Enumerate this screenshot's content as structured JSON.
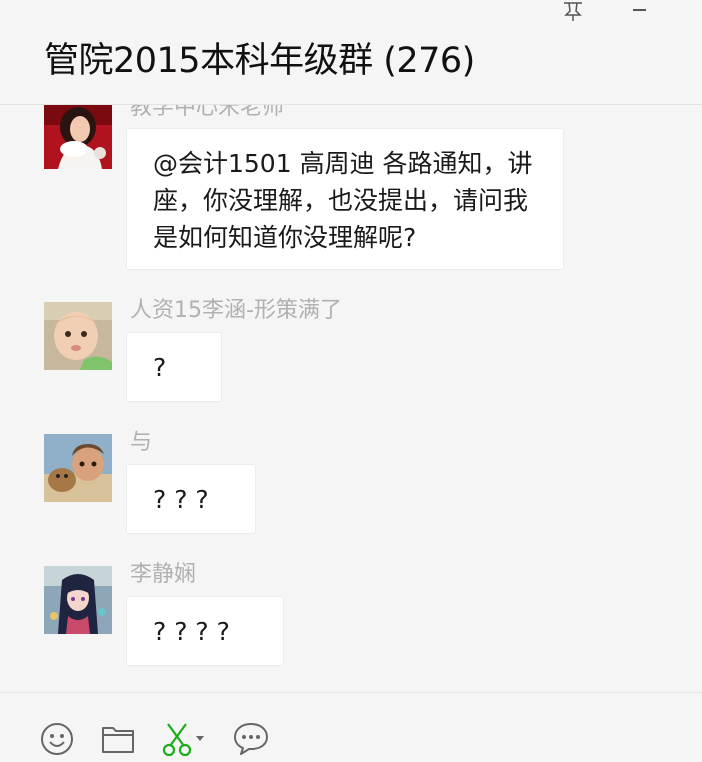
{
  "window": {
    "title": "管院2015本科年级群 (276)",
    "pin_icon": "pin-icon",
    "minimize_icon": "minimize-icon"
  },
  "messages": [
    {
      "sender": "教学中心宋老师",
      "avatar": "avatar-photo-woman",
      "text": "@会计1501 高周迪 各路通知，讲座，你没理解，也没提出，请问我是如何知道你没理解呢?"
    },
    {
      "sender": "人资15李涵-形策满了",
      "avatar": "avatar-photo-baby",
      "text": "?"
    },
    {
      "sender": "与",
      "avatar": "avatar-photo-man-with-animal",
      "text": "? ? ?"
    },
    {
      "sender": "李静娴",
      "avatar": "avatar-anime-girl",
      "text": "? ? ? ?"
    }
  ],
  "toolbar": {
    "items": [
      "emoji-icon",
      "folder-icon",
      "scissors-icon",
      "chat-history-icon"
    ],
    "scissors_color": "#1aad19"
  }
}
